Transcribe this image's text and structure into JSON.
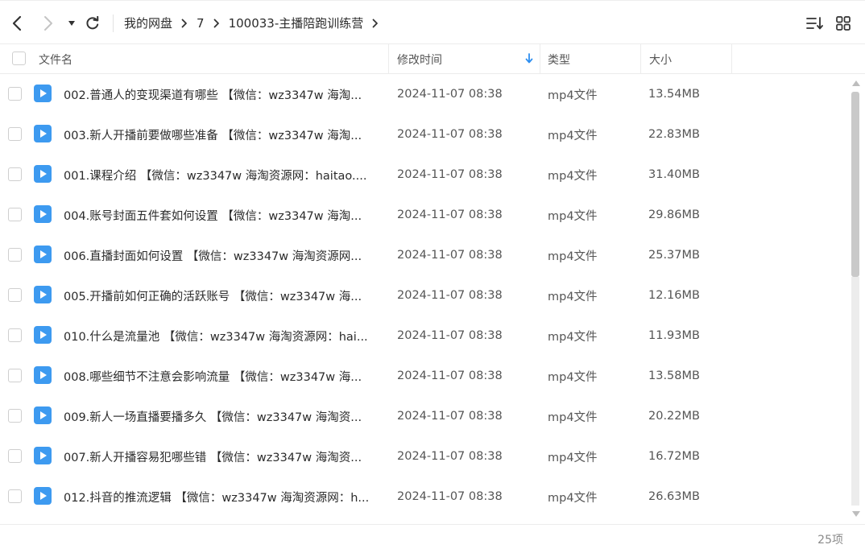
{
  "breadcrumb": [
    "我的网盘",
    "7",
    "100033-主播陪跑训练营"
  ],
  "columns": {
    "name": "文件名",
    "modified": "修改时间",
    "type": "类型",
    "size": "大小"
  },
  "files": [
    {
      "name": "002.普通人的变现渠道有哪些 【微信：wz3347w 海淘...",
      "modified": "2024-11-07 08:38",
      "type": "mp4文件",
      "size": "13.54MB"
    },
    {
      "name": "003.新人开播前要做哪些准备 【微信：wz3347w 海淘...",
      "modified": "2024-11-07 08:38",
      "type": "mp4文件",
      "size": "22.83MB"
    },
    {
      "name": "001.课程介绍 【微信：wz3347w 海淘资源网：haitao....",
      "modified": "2024-11-07 08:38",
      "type": "mp4文件",
      "size": "31.40MB"
    },
    {
      "name": "004.账号封面五件套如何设置 【微信：wz3347w 海淘...",
      "modified": "2024-11-07 08:38",
      "type": "mp4文件",
      "size": "29.86MB"
    },
    {
      "name": "006.直播封面如何设置 【微信：wz3347w 海淘资源网...",
      "modified": "2024-11-07 08:38",
      "type": "mp4文件",
      "size": "25.37MB"
    },
    {
      "name": "005.开播前如何正确的活跃账号 【微信：wz3347w 海...",
      "modified": "2024-11-07 08:38",
      "type": "mp4文件",
      "size": "12.16MB"
    },
    {
      "name": "010.什么是流量池 【微信：wz3347w 海淘资源网：hai...",
      "modified": "2024-11-07 08:38",
      "type": "mp4文件",
      "size": "11.93MB"
    },
    {
      "name": "008.哪些细节不注意会影响流量 【微信：wz3347w 海...",
      "modified": "2024-11-07 08:38",
      "type": "mp4文件",
      "size": "13.58MB"
    },
    {
      "name": "009.新人一场直播要播多久 【微信：wz3347w 海淘资...",
      "modified": "2024-11-07 08:38",
      "type": "mp4文件",
      "size": "20.22MB"
    },
    {
      "name": "007.新人开播容易犯哪些错 【微信：wz3347w 海淘资...",
      "modified": "2024-11-07 08:38",
      "type": "mp4文件",
      "size": "16.72MB"
    },
    {
      "name": "012.抖音的推流逻辑 【微信：wz3347w 海淘资源网：h...",
      "modified": "2024-11-07 08:38",
      "type": "mp4文件",
      "size": "26.63MB"
    }
  ],
  "footer": {
    "count": "25项"
  },
  "colors": {
    "accent": "#2e8ff0",
    "file_icon": "#3d9af0"
  },
  "icons": [
    "back-icon",
    "forward-icon",
    "dropdown-icon",
    "refresh-icon",
    "chevron-right-icon",
    "sort-icon",
    "grid-view-icon",
    "video-file-icon",
    "sort-down-arrow-icon"
  ]
}
